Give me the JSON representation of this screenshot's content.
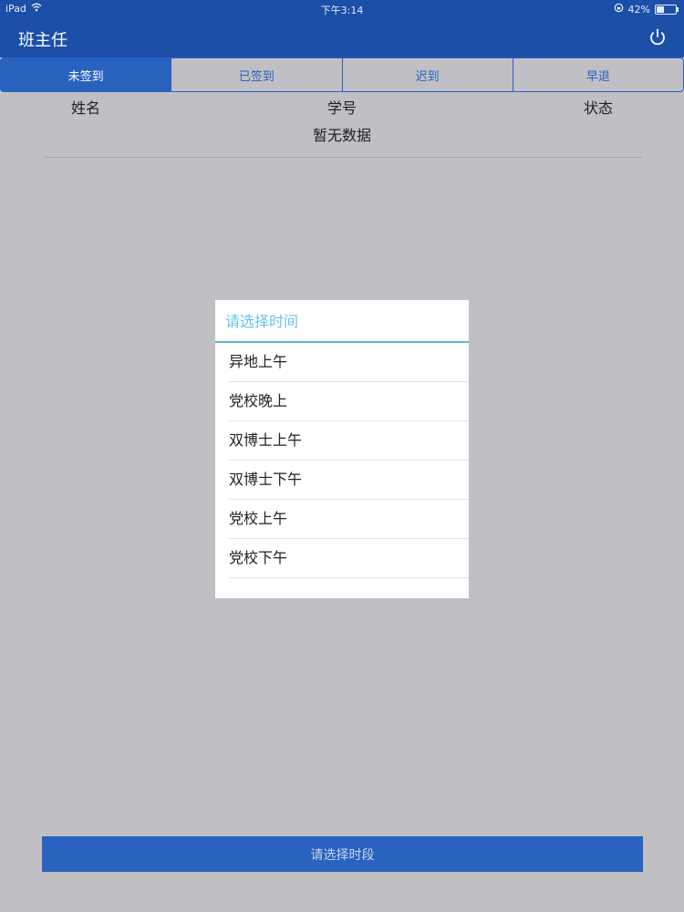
{
  "status_bar": {
    "device": "iPad",
    "time": "下午3:14",
    "battery": "42%",
    "battery_fraction": 0.42
  },
  "header": {
    "title": "班主任",
    "power_icon": "power-icon"
  },
  "tabs": [
    {
      "label": "未签到",
      "active": true
    },
    {
      "label": "已签到",
      "active": false
    },
    {
      "label": "迟到",
      "active": false
    },
    {
      "label": "早退",
      "active": false
    }
  ],
  "table": {
    "columns": [
      "姓名",
      "学号",
      "状态"
    ],
    "empty_text": "暂无数据"
  },
  "dialog": {
    "title": "请选择时间",
    "options": [
      "异地上午",
      "党校晚上",
      "双博士上午",
      "双博士下午",
      "党校上午",
      "党校下午"
    ]
  },
  "bottom_button": {
    "label": "请选择时段"
  },
  "colors": {
    "primary": "#2a62c0",
    "navbar": "#1c4fa8",
    "background": "#c0bfc4",
    "dialog_title": "#68c3e2"
  }
}
